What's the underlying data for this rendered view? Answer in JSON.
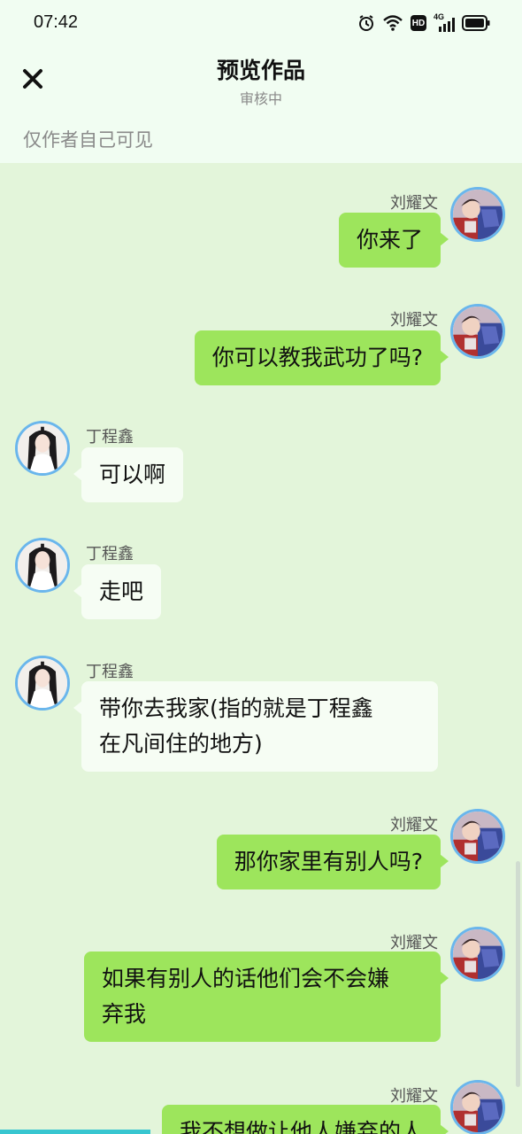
{
  "status_bar": {
    "time": "07:42",
    "hd_label": "HD",
    "network_label": "4G"
  },
  "header": {
    "title": "预览作品",
    "subtitle": "审核中",
    "notice": "仅作者自己可见"
  },
  "colors": {
    "background": "#e3f5da",
    "header_bg": "#f1fdf2",
    "my_bubble": "#9de55c",
    "their_bubble": "#f6fdf4",
    "avatar_ring": "#6ab6ec"
  },
  "messages": [
    {
      "sender": "刘耀文",
      "side": "right",
      "text": "你来了"
    },
    {
      "sender": "刘耀文",
      "side": "right",
      "text": "你可以教我武功了吗?"
    },
    {
      "sender": "丁程鑫",
      "side": "left",
      "text": "可以啊"
    },
    {
      "sender": "丁程鑫",
      "side": "left",
      "text": "走吧"
    },
    {
      "sender": "丁程鑫",
      "side": "left",
      "text_line1": "带你去我家(指的就是丁程鑫",
      "text_line2": "在凡间住的地方)"
    },
    {
      "sender": "刘耀文",
      "side": "right",
      "text": "那你家里有别人吗?"
    },
    {
      "sender": "刘耀文",
      "side": "right",
      "text_line1": "如果有别人的话他们会不会嫌",
      "text_line2": "弃我"
    },
    {
      "sender": "刘耀文",
      "side": "right",
      "text": "我不想做让他人嫌弃的人"
    }
  ]
}
